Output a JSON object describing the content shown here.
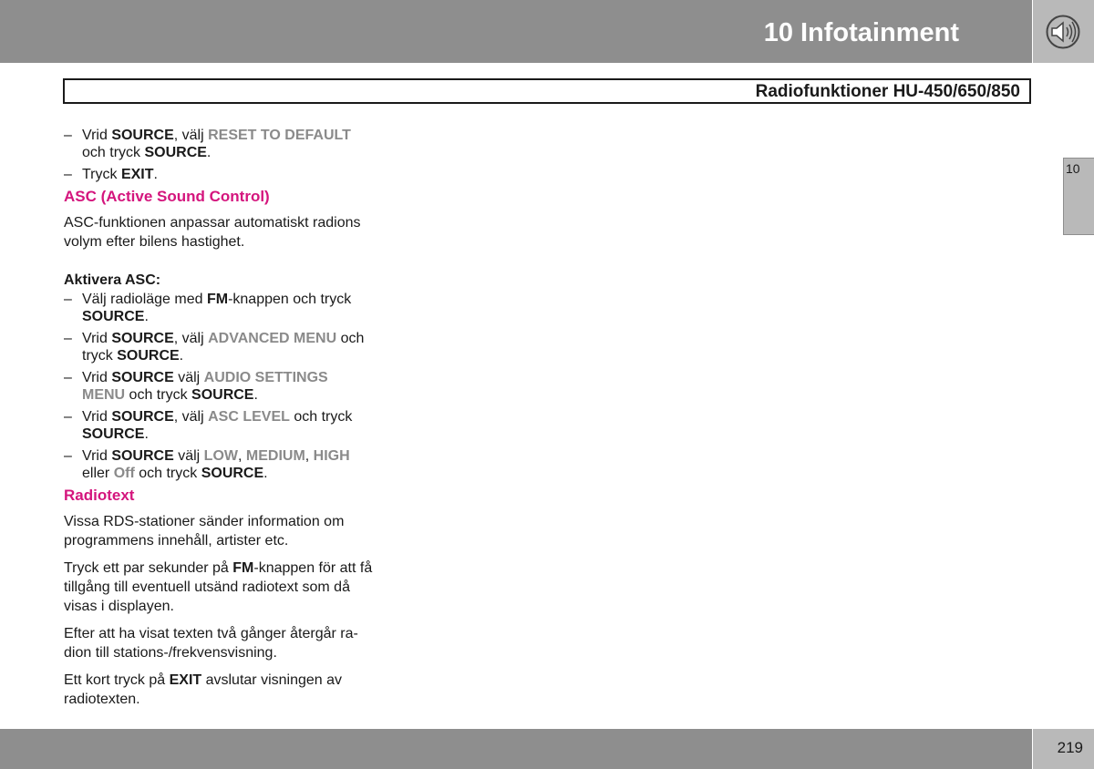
{
  "header": {
    "chapter_title": "10 Infotainment",
    "section_title": "Radiofunktioner HU-450/650/850",
    "icon": "speaker-icon"
  },
  "side_tab": {
    "label": "10"
  },
  "footer": {
    "page_number": "219"
  },
  "content": {
    "intro_items": [
      {
        "t1": "Vrid ",
        "b1": "SOURCE",
        "t2": ", välj ",
        "g1": "RESET TO DEFAULT",
        "t3": " och tryck ",
        "b2": "SOURCE",
        "t4": "."
      },
      {
        "t1": "Tryck ",
        "b1": "EXIT",
        "t2": "."
      }
    ],
    "asc_heading": "ASC (Active Sound Control)",
    "asc_paragraph": "ASC-funktionen anpassar automatiskt radi­ons volym efter bilens hastighet.",
    "activate_heading": "Aktivera ASC:",
    "activate_items": [
      {
        "t1": "Välj radioläge med ",
        "b1": "FM",
        "t2": "-knappen och tryck ",
        "b2": "SOURCE",
        "t3": "."
      },
      {
        "t1": "Vrid ",
        "b1": "SOURCE",
        "t2": ", välj ",
        "g1": "ADVANCED MENU",
        "t3": " och tryck ",
        "b2": "SOURCE",
        "t4": "."
      },
      {
        "t1": "Vrid ",
        "b1": "SOURCE",
        "t2": " välj ",
        "g1": "AUDIO SETTINGS MENU",
        "t3": " och tryck ",
        "b2": "SOURCE",
        "t4": "."
      },
      {
        "t1": "Vrid ",
        "b1": "SOURCE",
        "t2": ", välj ",
        "g1": "ASC LEVEL",
        "t3": " och tryck ",
        "b2": "SOURCE",
        "t4": "."
      },
      {
        "t1": "Vrid ",
        "b1": "SOURCE",
        "t2": " välj ",
        "g1": "LOW",
        "t3": ", ",
        "g2": "MEDIUM",
        "t4": ", ",
        "g3": "HIGH",
        "t5": " eller ",
        "g4": "Off",
        "t6": " och tryck ",
        "b2": "SOURCE",
        "t7": "."
      }
    ],
    "radiotext_heading": "Radiotext",
    "radiotext_p1": "Vissa RDS-stationer sänder information om programmens innehåll, artister etc.",
    "radiotext_p2": {
      "t1": "Tryck ett par sekunder på ",
      "b1": "FM",
      "t2": "-knappen för att få tillgång till eventuell utsänd radiotext som då visas i displayen."
    },
    "radiotext_p3": "Efter att ha visat texten två gånger återgår ra­dion till stations-/frekvensvisning.",
    "radiotext_p4": {
      "t1": "Ett kort tryck på ",
      "b1": "EXIT",
      "t2": " avslutar visningen av radiotexten."
    }
  }
}
